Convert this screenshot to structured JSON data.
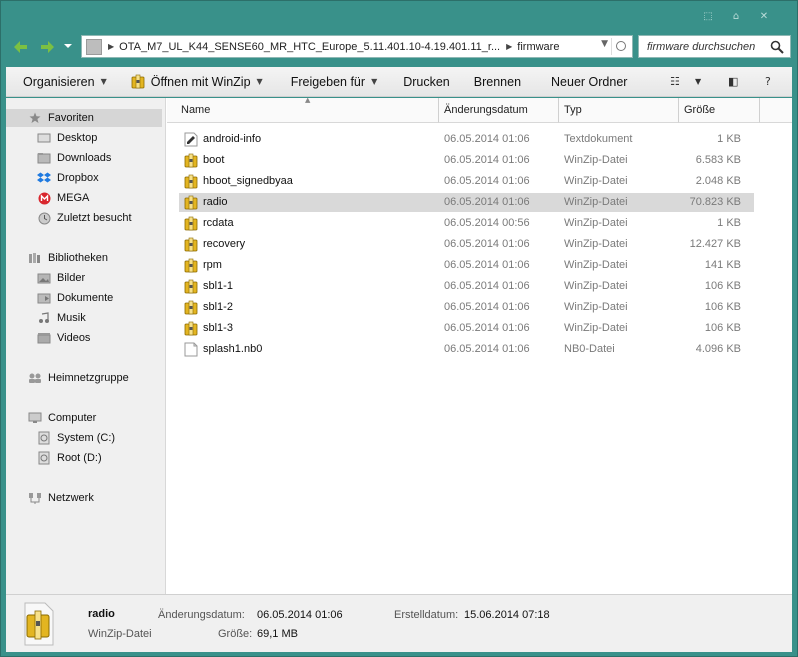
{
  "window": {
    "buttons": [
      "⬚",
      "⌂",
      "✕"
    ]
  },
  "address": {
    "segments": [
      "OTA_M7_UL_K44_SENSE60_MR_HTC_Europe_5.11.401.10-4.19.401.11_r...",
      "firmware"
    ]
  },
  "search": {
    "placeholder": "firmware durchsuchen"
  },
  "toolbar": {
    "organize": "Organisieren",
    "open_with": "Öffnen mit WinZip",
    "share": "Freigeben für",
    "print": "Drucken",
    "burn": "Brennen",
    "new_folder": "Neuer Ordner"
  },
  "sidebar": {
    "favorites": "Favoriten",
    "desktop": "Desktop",
    "downloads": "Downloads",
    "dropbox": "Dropbox",
    "mega": "MEGA",
    "recent": "Zuletzt besucht",
    "libraries": "Bibliotheken",
    "pictures": "Bilder",
    "documents": "Dokumente",
    "music": "Musik",
    "videos": "Videos",
    "homegroup": "Heimnetzgruppe",
    "computer": "Computer",
    "drive_c": "System (C:)",
    "drive_d": "Root (D:)",
    "network": "Netzwerk"
  },
  "columns": {
    "name": "Name",
    "date": "Änderungsdatum",
    "type": "Typ",
    "size": "Größe"
  },
  "files": [
    {
      "name": "android-info",
      "date": "06.05.2014 01:06",
      "type": "Textdokument",
      "size": "1 KB",
      "icon": "text-file-icon"
    },
    {
      "name": "boot",
      "date": "06.05.2014 01:06",
      "type": "WinZip-Datei",
      "size": "6.583 KB",
      "icon": "winzip-icon"
    },
    {
      "name": "hboot_signedbyaa",
      "date": "06.05.2014 01:06",
      "type": "WinZip-Datei",
      "size": "2.048 KB",
      "icon": "winzip-icon"
    },
    {
      "name": "radio",
      "date": "06.05.2014 01:06",
      "type": "WinZip-Datei",
      "size": "70.823 KB",
      "icon": "winzip-icon"
    },
    {
      "name": "rcdata",
      "date": "06.05.2014 00:56",
      "type": "WinZip-Datei",
      "size": "1 KB",
      "icon": "winzip-icon"
    },
    {
      "name": "recovery",
      "date": "06.05.2014 01:06",
      "type": "WinZip-Datei",
      "size": "12.427 KB",
      "icon": "winzip-icon"
    },
    {
      "name": "rpm",
      "date": "06.05.2014 01:06",
      "type": "WinZip-Datei",
      "size": "141 KB",
      "icon": "winzip-icon"
    },
    {
      "name": "sbl1-1",
      "date": "06.05.2014 01:06",
      "type": "WinZip-Datei",
      "size": "106 KB",
      "icon": "winzip-icon"
    },
    {
      "name": "sbl1-2",
      "date": "06.05.2014 01:06",
      "type": "WinZip-Datei",
      "size": "106 KB",
      "icon": "winzip-icon"
    },
    {
      "name": "sbl1-3",
      "date": "06.05.2014 01:06",
      "type": "WinZip-Datei",
      "size": "106 KB",
      "icon": "winzip-icon"
    },
    {
      "name": "splash1.nb0",
      "date": "06.05.2014 01:06",
      "type": "NB0-Datei",
      "size": "4.096 KB",
      "icon": "blank-file-icon"
    }
  ],
  "details": {
    "name": "radio",
    "type": "WinZip-Datei",
    "modified_label": "Änderungsdatum:",
    "modified_value": "06.05.2014 01:06",
    "created_label": "Erstelldatum:",
    "created_value": "15.06.2014 07:18",
    "size_label": "Größe:",
    "size_value": "69,1 MB"
  },
  "colors": {
    "frame": "#39918a",
    "selection": "#d9d9d9",
    "nav_arrow": "#7bc043"
  }
}
